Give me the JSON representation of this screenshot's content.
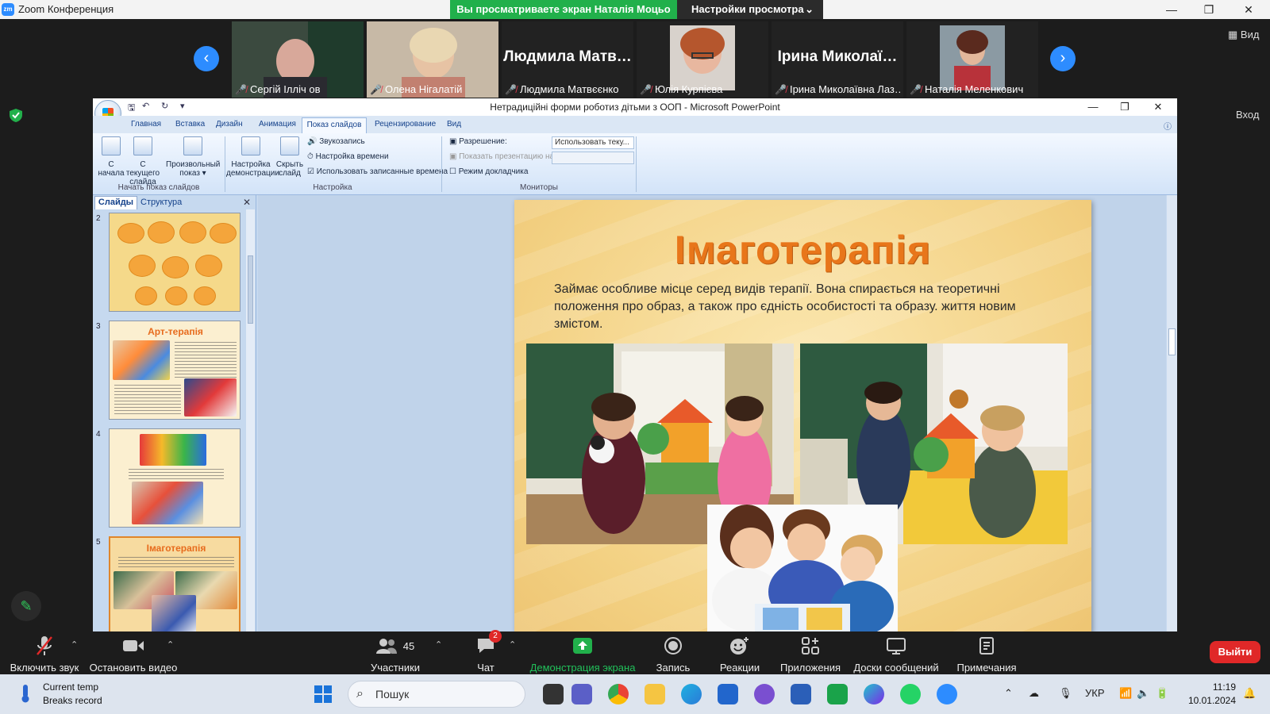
{
  "zoom": {
    "window_title": "Zoom Конференция",
    "share_banner": "Вы просматриваете экран Наталія Моцьо",
    "view_options": "Настройки просмотра",
    "view_label": "Вид",
    "enter_label": "Вход"
  },
  "participants": [
    {
      "name": "Сергій Ілліч ов",
      "display": "Сергій Ілліч ов"
    },
    {
      "name": "Олена Нігалатій"
    },
    {
      "name": "Людмила Матвєєнко",
      "big_name": "Людмила Матв…"
    },
    {
      "name": "Юлія Курпієва"
    },
    {
      "name": "Ірина Миколаївна Лаз…",
      "big_name": "Ірина Миколаї…"
    },
    {
      "name": "Наталія Меленкович"
    }
  ],
  "ppt": {
    "title": "Нетрадиційні форми роботиз дітьми з ООП - Microsoft PowerPoint",
    "tabs": [
      "Главная",
      "Вставка",
      "Дизайн",
      "Анимация",
      "Показ слайдов",
      "Рецензирование",
      "Вид"
    ],
    "active_tab": "Показ слайдов",
    "ribbon": {
      "btn_from_start": [
        "С",
        "начала"
      ],
      "btn_from_current": [
        "С текущего",
        "слайда"
      ],
      "btn_custom": [
        "Произвольный",
        "показ ▾"
      ],
      "group_start": "Начать показ слайдов",
      "btn_setup": [
        "Настройка",
        "демонстрации"
      ],
      "btn_hide": [
        "Скрыть",
        "слайд"
      ],
      "record": "Звукозапись",
      "timing": "Настройка времени",
      "use_timings": "Использовать записанные времена",
      "group_setup": "Настройка",
      "resolution_label": "Разрешение:",
      "resolution_value": "Использовать теку...",
      "show_on_label": "Показать презентацию на:",
      "presenter_view": "Режим докладчика",
      "group_monitors": "Мониторы"
    },
    "panel": {
      "tab_slides": "Слайды",
      "tab_outline": "Структура",
      "thumbs": [
        {
          "num": "2",
          "title": ""
        },
        {
          "num": "3",
          "title": "Арт-терапія"
        },
        {
          "num": "4",
          "title": ""
        },
        {
          "num": "5",
          "title": "Імаготерапія"
        }
      ]
    },
    "slide": {
      "title": "Імаготерапія",
      "text": "Займає особливе місце серед видів терапії. Вона спирається на теоретичні положення про образ, а також про єдність особистості та образу. життя новим змістом."
    }
  },
  "toolbar": {
    "unmute": "Включить звук",
    "stop_video": "Остановить видео",
    "participants": "Участники",
    "participants_count": "45",
    "chat": "Чат",
    "chat_badge": "2",
    "share": "Демонстрация экрана",
    "record": "Запись",
    "reactions": "Реакции",
    "apps": "Приложения",
    "whiteboards": "Доски сообщений",
    "notes": "Примечания",
    "leave": "Выйти"
  },
  "taskbar": {
    "weather_temp": "Current temp",
    "weather_desc": "Breaks record",
    "search_placeholder": "Пошук",
    "lang": "УКР",
    "time": "11:19",
    "date": "10.01.2024"
  },
  "colors": {
    "zoom_blue": "#2d8cff",
    "share_green": "#21b04b",
    "leave_red": "#e02828",
    "slide_title": "#e8761a"
  }
}
